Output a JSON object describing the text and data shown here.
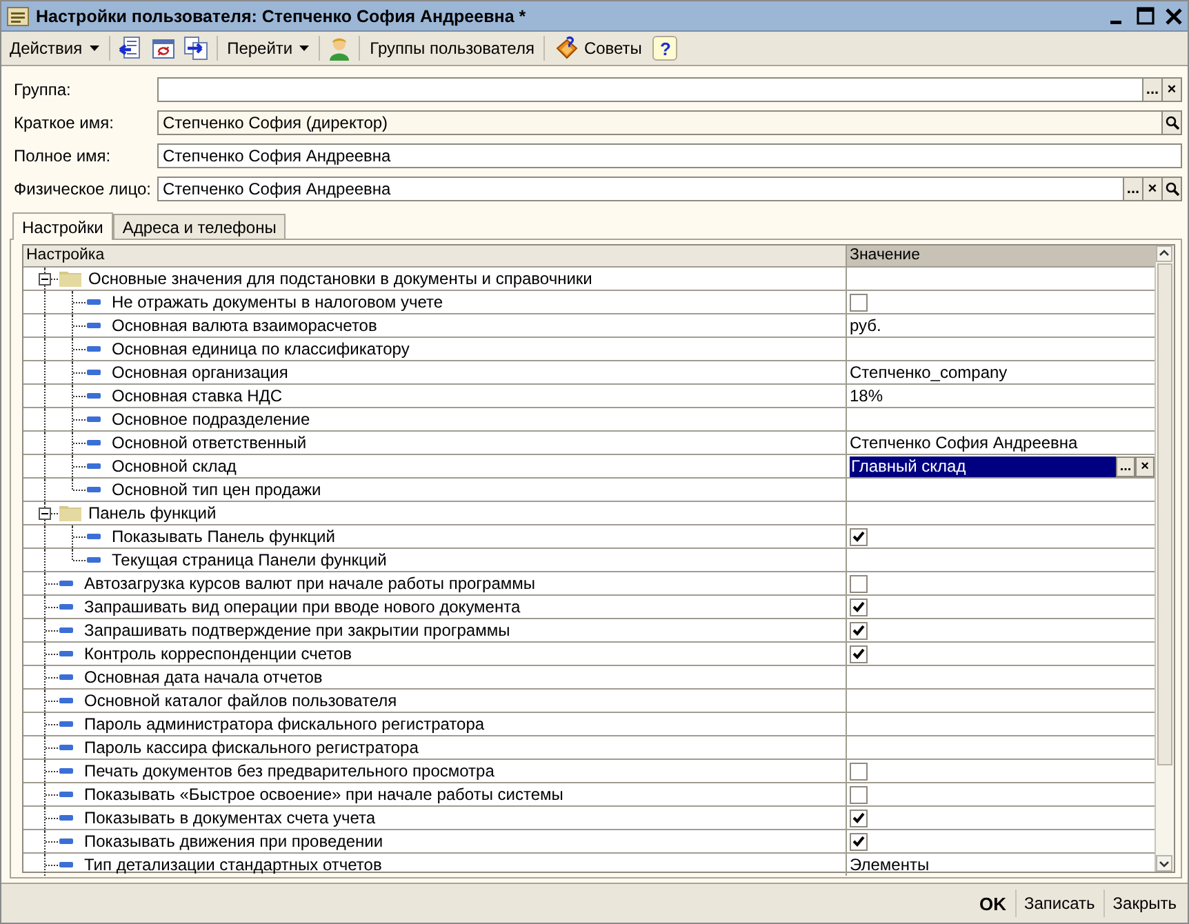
{
  "window": {
    "title": "Настройки пользователя: Степченко София Андреевна *"
  },
  "toolbar": [
    [
      {
        "kind": "menu",
        "label": "Действия"
      }
    ],
    [
      {
        "kind": "icon"
      },
      {
        "kind": "icon"
      },
      {
        "kind": "icon"
      }
    ],
    [
      {
        "kind": "menu",
        "label": "Перейти"
      }
    ],
    [
      {
        "kind": "icon"
      }
    ],
    [
      {
        "kind": "button",
        "label": "Группы пользователя"
      }
    ],
    [
      {
        "kind": "button",
        "label": "Советы"
      },
      {
        "kind": "help",
        "label": "?"
      }
    ]
  ],
  "fields": [
    {
      "label": "Группа:",
      "readonly": false,
      "buttons": [
        {
          "kind": "text",
          "label": "..."
        },
        {
          "kind": "text",
          "label": "×"
        }
      ]
    },
    {
      "label": "Краткое имя:",
      "value": "Степченко София (директор)",
      "readonly": true,
      "buttons": [
        {
          "kind": "search"
        }
      ]
    },
    {
      "label": "Полное имя:",
      "value": "Степченко София Андреевна",
      "readonly": false
    },
    {
      "label": "Физическое лицо:",
      "value": "Степченко София Андреевна",
      "readonly": false,
      "buttons": [
        {
          "kind": "text",
          "label": "..."
        },
        {
          "kind": "text",
          "label": "×"
        },
        {
          "kind": "search"
        }
      ]
    }
  ],
  "tabs": [
    {
      "label": "Настройки",
      "selected": true
    },
    {
      "label": "Адреса и телефоны",
      "selected": false
    }
  ],
  "table": {
    "columns": [
      "Настройка",
      "Значение"
    ],
    "rows": [
      {
        "kind": "group",
        "name": "Основные значения для подстановки в документы и справочники",
        "expanded": true,
        "children": [
          {
            "kind": "item",
            "name": "Не отражать документы в налоговом учете",
            "value": {
              "kind": "checkbox",
              "checked": false
            }
          },
          {
            "kind": "item",
            "name": "Основная валюта взаиморасчетов",
            "value": {
              "kind": "text",
              "text": "руб."
            }
          },
          {
            "kind": "item",
            "name": "Основная единица по классификатору"
          },
          {
            "kind": "item",
            "name": "Основная организация",
            "value": {
              "kind": "text",
              "text": "Степченко_company"
            }
          },
          {
            "kind": "item",
            "name": "Основная ставка НДС",
            "value": {
              "kind": "text",
              "text": "18%"
            }
          },
          {
            "kind": "item",
            "name": "Основное подразделение"
          },
          {
            "kind": "item",
            "name": "Основной ответственный",
            "value": {
              "kind": "text",
              "text": "Степченко София Андреевна"
            }
          },
          {
            "kind": "item",
            "name": "Основной склад",
            "value": {
              "kind": "editing",
              "text": "Главный склад",
              "buttons": [
                "...",
                "×"
              ]
            }
          },
          {
            "kind": "item",
            "name": "Основной тип цен продажи"
          }
        ]
      },
      {
        "kind": "group",
        "name": "Панель функций",
        "expanded": true,
        "children": [
          {
            "kind": "item",
            "name": "Показывать Панель функций",
            "value": {
              "kind": "checkbox",
              "checked": true
            }
          },
          {
            "kind": "item",
            "name": "Текущая страница Панели функций"
          }
        ]
      },
      {
        "kind": "item",
        "name": "Автозагрузка курсов валют при начале работы программы",
        "value": {
          "kind": "checkbox",
          "checked": false
        }
      },
      {
        "kind": "item",
        "name": "Запрашивать вид операции при вводе нового документа",
        "value": {
          "kind": "checkbox",
          "checked": true
        }
      },
      {
        "kind": "item",
        "name": "Запрашивать подтверждение при закрытии программы",
        "value": {
          "kind": "checkbox",
          "checked": true
        }
      },
      {
        "kind": "item",
        "name": "Контроль корреспонденции счетов",
        "value": {
          "kind": "checkbox",
          "checked": true
        }
      },
      {
        "kind": "item",
        "name": "Основная дата начала отчетов"
      },
      {
        "kind": "item",
        "name": "Основной каталог файлов пользователя"
      },
      {
        "kind": "item",
        "name": "Пароль администратора фискального регистратора"
      },
      {
        "kind": "item",
        "name": "Пароль кассира фискального регистратора"
      },
      {
        "kind": "item",
        "name": "Печать документов без предварительного просмотра",
        "value": {
          "kind": "checkbox",
          "checked": false
        }
      },
      {
        "kind": "item",
        "name": "Показывать «Быстрое освоение» при начале работы системы",
        "value": {
          "kind": "checkbox",
          "checked": false
        }
      },
      {
        "kind": "item",
        "name": "Показывать в документах счета учета",
        "value": {
          "kind": "checkbox",
          "checked": true
        }
      },
      {
        "kind": "item",
        "name": "Показывать движения при проведении",
        "value": {
          "kind": "checkbox",
          "checked": true
        }
      },
      {
        "kind": "item",
        "name": "Тип детализации стандартных отчетов",
        "value": {
          "kind": "text",
          "text": "Элементы"
        }
      }
    ]
  },
  "footer": [
    {
      "label": "OK",
      "default": true
    },
    {
      "label": "Записать",
      "default": false
    },
    {
      "label": "Закрыть",
      "default": false
    }
  ]
}
